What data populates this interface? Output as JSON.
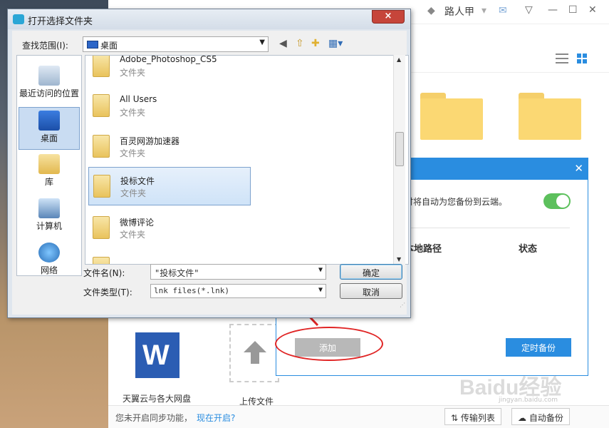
{
  "background_app": {
    "user_name": "路人甲",
    "status_text": "您未开启同步功能，",
    "enable_link": "现在开启?",
    "transfer_button": "传输列表",
    "auto_backup_button": "自动备份",
    "file_tiles": [
      {
        "label": "天翼云与各大网盘"
      },
      {
        "label": "上传文件"
      }
    ]
  },
  "backup_panel": {
    "description": "时将自动为您备份到云端。",
    "column_path": "本地路径",
    "column_status": "状态",
    "add_button": "添加",
    "schedule_button": "定时备份",
    "toggle_on": true
  },
  "dialog": {
    "title": "打开选择文件夹",
    "look_in_label": "查找范围(I):",
    "look_in_value": "桌面",
    "places": [
      {
        "label": "最近访问的位置",
        "icon": "recent-places-icon"
      },
      {
        "label": "桌面",
        "icon": "desktop-icon"
      },
      {
        "label": "库",
        "icon": "library-icon"
      },
      {
        "label": "计算机",
        "icon": "computer-icon"
      },
      {
        "label": "网络",
        "icon": "network-icon"
      }
    ],
    "items": [
      {
        "name": "Adobe_Photoshop_CS5",
        "type": "文件夹"
      },
      {
        "name": "All Users",
        "type": "文件夹"
      },
      {
        "name": "百灵网游加速器",
        "type": "文件夹"
      },
      {
        "name": "投标文件",
        "type": "文件夹"
      },
      {
        "name": "微博评论",
        "type": "文件夹"
      }
    ],
    "filename_label": "文件名(N):",
    "filename_value": "\"投标文件\"",
    "filetype_label": "文件类型(T):",
    "filetype_value": "lnk files(*.lnk)",
    "ok_button": "确定",
    "cancel_button": "取消",
    "close_button": "×"
  },
  "colors": {
    "accent": "#2a8de0",
    "annotation": "#e02424",
    "toggle": "#5cc05c"
  }
}
